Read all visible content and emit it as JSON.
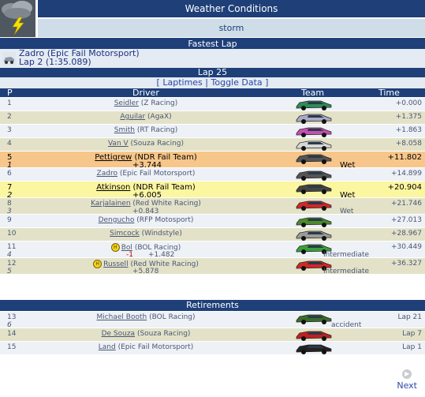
{
  "weather": {
    "title": "Weather Conditions",
    "value": "storm",
    "icon": "storm-icon"
  },
  "fastest_lap": {
    "title": "Fastest Lap",
    "driver": "Zadro (Epic Fail Motorsport)",
    "lap": "Lap 2 (1:35.089)"
  },
  "lap": {
    "title": "Lap 25",
    "laptimes": "Laptimes",
    "toggle": "Toggle Data",
    "open": "[",
    "sep": "|",
    "close": "]"
  },
  "columns": {
    "p": "P",
    "driver": "Driver",
    "team": "Team",
    "time": "Time"
  },
  "rows": [
    {
      "pos": "1",
      "driver": "Seidler",
      "team": "(Z Racing)",
      "time": "+0.000",
      "style": "odd"
    },
    {
      "pos": "2",
      "driver": "Aguilar",
      "team": "(AgaX)",
      "time": "+1.375",
      "style": "even"
    },
    {
      "pos": "3",
      "driver": "Smith",
      "team": "(RT Racing)",
      "time": "+1.863",
      "style": "odd"
    },
    {
      "pos": "4",
      "driver": "Van V",
      "team": "(Souza Racing)",
      "time": "+8.058",
      "style": "even"
    },
    {
      "pos": "5",
      "driver": "Pettigrew",
      "team": "(NDR Fail Team)",
      "time": "+11.802",
      "sub_pos": "1",
      "sub_gap": "+3.744",
      "tyre": "Wet",
      "style": "orange"
    },
    {
      "pos": "6",
      "driver": "Zadro",
      "team": "(Epic Fail Motorsport)",
      "time": "+14.899",
      "style": "odd"
    },
    {
      "pos": "7",
      "driver": "Atkinson",
      "team": "(NDR Fail Team)",
      "time": "+20.904",
      "sub_pos": "2",
      "sub_gap": "+6.005",
      "tyre": "Wet",
      "style": "yellow"
    },
    {
      "pos": "8",
      "driver": "Karjalainen",
      "team": "(Red White Racing)",
      "time": "+21.746",
      "sub_pos": "3",
      "sub_gap": "+0.843",
      "tyre": "Wet",
      "style": "even"
    },
    {
      "pos": "9",
      "driver": "Dengucho",
      "team": "(RFP Motosport)",
      "time": "+27.013",
      "style": "odd"
    },
    {
      "pos": "10",
      "driver": "Simcock",
      "team": "(Windstyle)",
      "time": "+28.967",
      "style": "even"
    },
    {
      "pos": "11",
      "driver": "Bol",
      "team": "(BOL Racing)",
      "time": "+30.449",
      "sub_pos": "4",
      "sub_change": "-1",
      "sub_gap": "+1.482",
      "tyre": "Intermediate",
      "style": "odd",
      "badge": "H"
    },
    {
      "pos": "12",
      "driver": "Russell",
      "team": "(Red White Racing)",
      "time": "+36.327",
      "sub_pos": "5",
      "sub_gap": "+5.878",
      "tyre": "Intermediate",
      "style": "even",
      "badge": "H"
    }
  ],
  "retirements": {
    "title": "Retirements",
    "rows": [
      {
        "pos": "13",
        "driver": "Michael Booth",
        "team": "(BOL Racing)",
        "time": "Lap 21",
        "sub_pos": "6",
        "reason": "accident",
        "style": "odd"
      },
      {
        "pos": "14",
        "driver": "De Souza",
        "team": "(Souza Racing)",
        "time": "Lap 7",
        "style": "even"
      },
      {
        "pos": "15",
        "driver": "Land",
        "team": "(Epic Fail Motorsport)",
        "time": "Lap 1",
        "style": "odd"
      }
    ]
  },
  "next": {
    "label": "Next",
    "icon": "next-arrow-icon"
  },
  "colors": {
    "header": "#1e3f78",
    "odd": "#eef1f6",
    "even": "#e3e2c8",
    "orange": "#f7c68a",
    "yellow": "#fbf6a0"
  }
}
